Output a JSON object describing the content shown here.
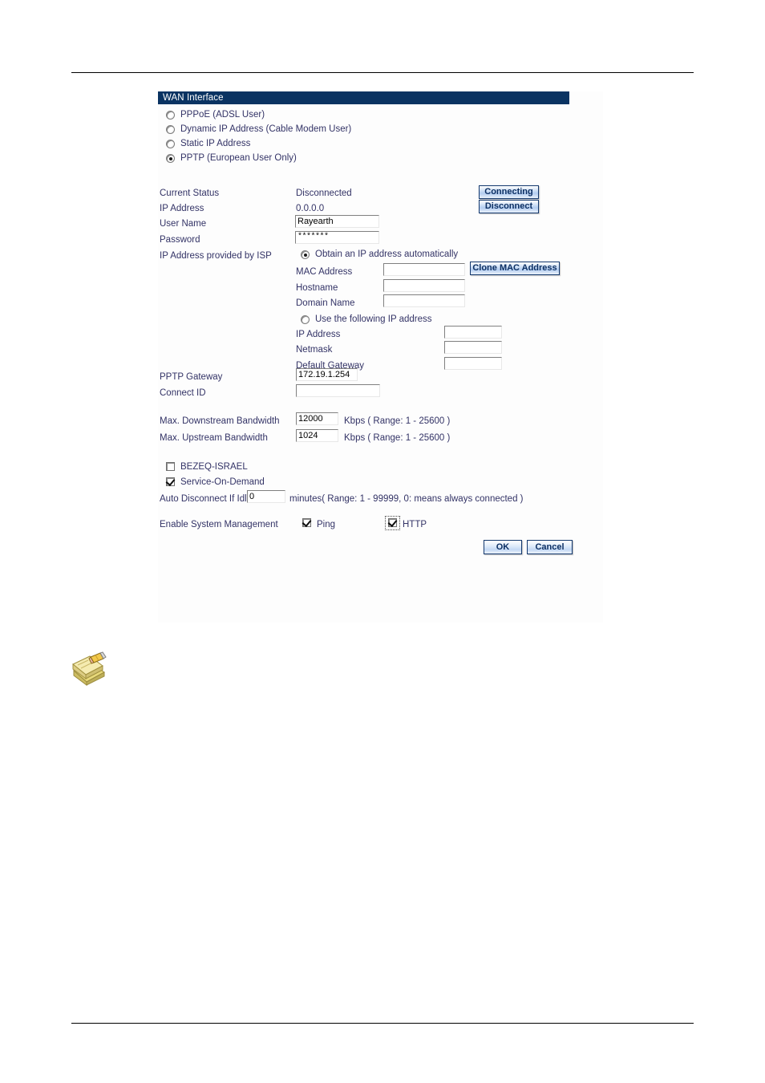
{
  "panel": {
    "title": "WAN Interface"
  },
  "wan_types": [
    {
      "label": "PPPoE (ADSL User)",
      "selected": false
    },
    {
      "label": "Dynamic IP Address (Cable Modem User)",
      "selected": false
    },
    {
      "label": "Static IP Address",
      "selected": false
    },
    {
      "label": "PPTP (European User Only)",
      "selected": true
    }
  ],
  "status": {
    "current_status_label": "Current Status",
    "current_status_value": "Disconnected",
    "ip_address_label": "IP Address",
    "ip_address_value": "0.0.0.0",
    "connecting_button": "Connecting",
    "disconnect_button": "Disconnect"
  },
  "credentials": {
    "user_name_label": "User Name",
    "user_name_value": "Rayearth",
    "password_label": "Password",
    "password_value": "*******",
    "password_placeholder": ""
  },
  "isp": {
    "section_label": "IP Address provided by ISP",
    "auto_option": "Obtain an IP address automatically",
    "auto_selected": true,
    "mac_address_label": "MAC Address",
    "mac_address_value": "",
    "clone_mac_button": "Clone MAC Address",
    "hostname_label": "Hostname",
    "hostname_value": "",
    "domain_name_label": "Domain Name",
    "domain_name_value": "",
    "manual_option": "Use the following IP address",
    "manual_selected": false,
    "ip_address_label": "IP Address",
    "ip_address_value": "",
    "netmask_label": "Netmask",
    "netmask_value": "",
    "default_gateway_label": "Default Gateway",
    "default_gateway_value": ""
  },
  "pptp": {
    "gateway_label": "PPTP Gateway",
    "gateway_value": "172.19.1.254",
    "connect_id_label": "Connect ID",
    "connect_id_value": ""
  },
  "bandwidth": {
    "downstream_label": "Max. Downstream Bandwidth",
    "downstream_value": "12000",
    "downstream_units": "Kbps  ( Range: 1 - 25600 )",
    "upstream_label": "Max. Upstream Bandwidth",
    "upstream_value": "1024",
    "upstream_units": "Kbps  ( Range: 1 - 25600 )"
  },
  "options": {
    "bezeq_label": "BEZEQ-ISRAEL",
    "bezeq_checked": false,
    "service_on_demand_label": "Service-On-Demand",
    "service_on_demand_checked": true,
    "auto_disconnect_label": "Auto Disconnect If Idle",
    "auto_disconnect_value": "0",
    "auto_disconnect_units": "minutes( Range: 1 - 99999, 0: means always connected )"
  },
  "system_management": {
    "label": "Enable System Management",
    "ping_label": "Ping",
    "ping_checked": true,
    "http_label": "HTTP",
    "http_checked": true
  },
  "actions": {
    "ok_button": "OK",
    "cancel_button": "Cancel"
  },
  "icons": {
    "note": "note-pencil-icon"
  },
  "colors": {
    "title_bar": "#0a3362",
    "label_text": "#333366",
    "button_border": "#13386e",
    "button_text": "#0c2f63",
    "panel_background": "#fdfdfd"
  }
}
